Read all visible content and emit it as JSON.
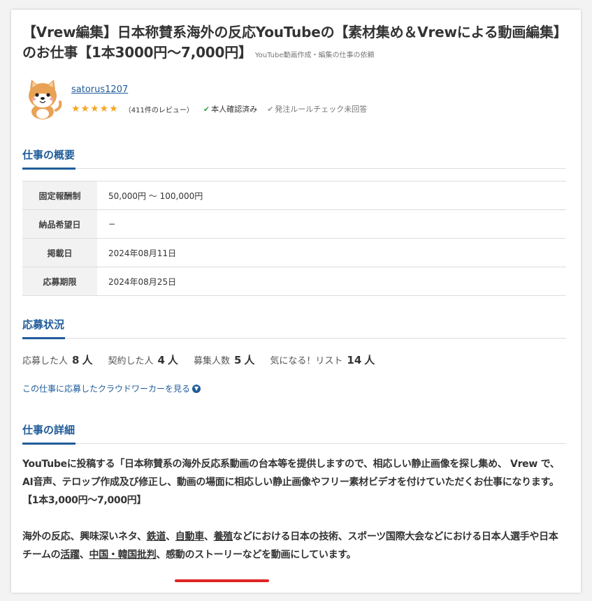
{
  "title": {
    "main": "【Vrew編集】日本称賛系海外の反応YouTubeの【素材集め＆Vrewによる動画編集】のお仕事【1本3000円〜7,000円】",
    "category": "YouTube動画作成・編集の仕事の依頼"
  },
  "client": {
    "name": "satorus1207",
    "stars": "★★★★★",
    "reviews": "（411件のレビュー）",
    "verified": "本人確認済み",
    "rule_check": "発注ルールチェック未回答"
  },
  "overview": {
    "heading": "仕事の概要",
    "rows": [
      {
        "label": "固定報酬制",
        "value": "50,000円 〜 100,000円"
      },
      {
        "label": "納品希望日",
        "value": "−"
      },
      {
        "label": "掲載日",
        "value": "2024年08月11日"
      },
      {
        "label": "応募期限",
        "value": "2024年08月25日"
      }
    ]
  },
  "status": {
    "heading": "応募状況",
    "applied_label": "応募した人",
    "applied_value": "8",
    "contracted_label": "契約した人",
    "contracted_value": "4",
    "recruit_label": "募集人数",
    "recruit_value": "5",
    "watch_label": "気になる！リスト",
    "watch_value": "14",
    "unit": "人",
    "workers_link": "この仕事に応募したクラウドワーカーを見る"
  },
  "detail": {
    "heading": "仕事の詳細",
    "para1": "YouTubeに投稿する「日本称賛系の海外反応系動画の台本等を提供しますので、相応しい静止画像を探し集め、 Vrew で、AI音声、テロップ作成及び修正し、動画の場面に相応しい静止画像やフリー素材ビデオを付けていただくお仕事になります。",
    "price": "【1本3,000円〜7,000円】",
    "para2_a": "海外の反応、興味深いネタ、",
    "para2_b": "鉄道",
    "para2_c": "、",
    "para2_d": "自動車",
    "para2_e": "、",
    "para2_f": "養殖",
    "para2_g": "などにおける日本の技術、スポーツ国際大会などにおける日本人選手や日本チームの",
    "para2_h": "活躍",
    "para2_i": "、",
    "para2_j": "中国・韓国批判",
    "para2_k": "、感動のストーリーなどを動画にしています。"
  },
  "colors": {
    "accent": "#1f5c99",
    "star": "#f5a623",
    "verified": "#3aa34a",
    "annotation": "#e02424"
  }
}
